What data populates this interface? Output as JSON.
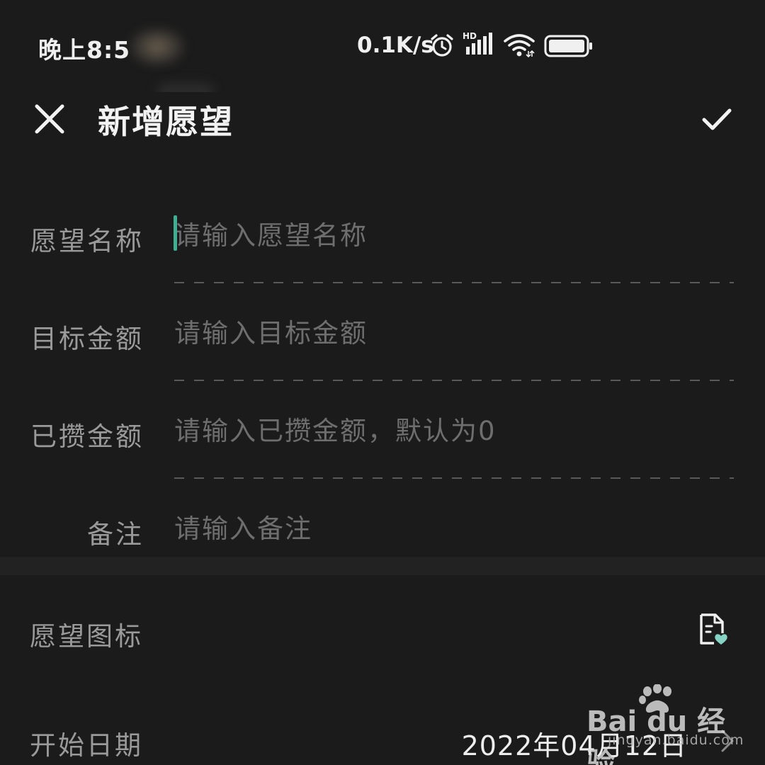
{
  "status_bar": {
    "time": "晚上8:5",
    "net_speed": "0.1K/s",
    "icons": [
      "alarm-icon",
      "hd-signal-icon",
      "wifi-icon",
      "battery-icon"
    ]
  },
  "header": {
    "title": "新增愿望",
    "close_icon": "close-icon",
    "confirm_icon": "check-icon"
  },
  "form": {
    "fields": [
      {
        "label": "愿望名称",
        "placeholder": "请输入愿望名称",
        "value": ""
      },
      {
        "label": "目标金额",
        "placeholder": "请输入目标金额",
        "value": ""
      },
      {
        "label": "已攒金额",
        "placeholder": "请输入已攒金额，默认为0",
        "value": ""
      },
      {
        "label": "备注",
        "placeholder": "请输入备注",
        "value": ""
      }
    ]
  },
  "settings": {
    "icon_row": {
      "label": "愿望图标",
      "icon": "wish-note-heart-icon"
    },
    "date_row": {
      "label": "开始日期",
      "value": "2022年04月12日"
    }
  },
  "colors": {
    "background": "#1b1b1b",
    "accent": "#3fae93",
    "label": "#9a9a9a",
    "placeholder": "#6e6e6e",
    "text": "#ededed"
  },
  "watermark": {
    "brand": "Bai du 经验",
    "url": "jingyan.baidu.com"
  }
}
